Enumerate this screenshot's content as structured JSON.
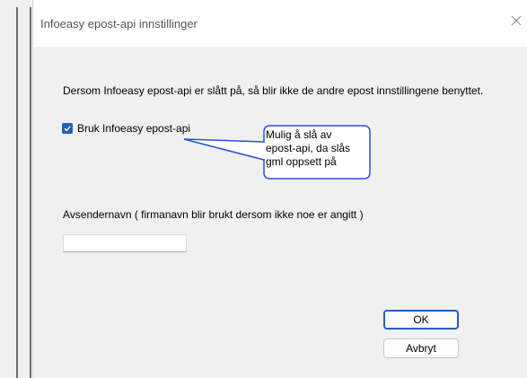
{
  "window": {
    "title": "Infoeasy epost-api innstillinger"
  },
  "content": {
    "info_text": "Dersom Infoeasy epost-api er slått på, så blir ikke de andre epost innstillingene benyttet.",
    "checkbox": {
      "label": "Bruk Infoeasy epost-api",
      "checked": true
    },
    "callout_lines": [
      "Mulig å slå av",
      "epost-api, da slås",
      "gml oppsett på"
    ],
    "sender_label": "Avsendernavn ( firmanavn blir brukt dersom ikke noe er angitt )",
    "sender_value": ""
  },
  "buttons": {
    "ok": "OK",
    "cancel": "Avbryt"
  },
  "colors": {
    "accent": "#1e62b8",
    "callout_border": "#2a4fd6"
  }
}
